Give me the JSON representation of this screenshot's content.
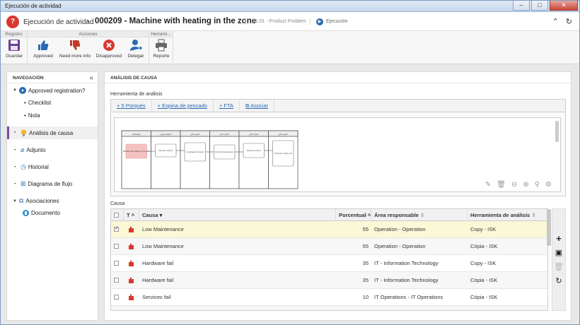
{
  "window": {
    "title": "Ejecución de actividad"
  },
  "header": {
    "breadcrumb": "Ejecución de actividad",
    "record": "000209 - Machine with heating in the zone",
    "category": "01.01 - Product Problem",
    "status": "Ejecución"
  },
  "ribbon": {
    "groups": {
      "registro": "Registro",
      "acciones": "Acciones",
      "herramientas": "Herrami..."
    },
    "buttons": {
      "guardar": "Guardar",
      "approved": "Approved",
      "need_more_info": "Need more info",
      "disapproved": "Disapproved",
      "delegar": "Delegar",
      "reporte": "Reporte"
    }
  },
  "nav": {
    "title": "NAVEGACIÓN",
    "items": {
      "approved": "Approved registration?",
      "checklist": "Checklist",
      "nota": "Nota",
      "analisis": "Análisis de causa",
      "adjunto": "Adjunto",
      "historial": "Historial",
      "diagrama": "Diagrama de flujo",
      "asociaciones": "Asociaciones",
      "documento": "Documento"
    }
  },
  "content": {
    "title": "ANÁLISIS DE CAUSA",
    "tool_label": "Herramienta de análisis",
    "tabs": {
      "t1": "5 Porqués",
      "t2": "Espina de pescado",
      "t3": "FTA",
      "t4": "Asociar"
    },
    "diagram": {
      "headers": [
        "Ishikawa",
        "¿Qué pasó?",
        "¿Por qué?",
        "¿Por qué?",
        "¿Por qué?",
        "¿Por qué?"
      ],
      "boxes": [
        "Machine with heating in the zone",
        "Stop the machine",
        "Investigate the cause",
        "Check the temperature",
        "Verify the sensors",
        "Check the cooling unit"
      ]
    },
    "cause_label": "Causa",
    "grid": {
      "headers": {
        "t": "T",
        "causa": "Causa",
        "porcentual": "Porcentual",
        "area": "Área responsable",
        "herramienta": "Herramienta de análisis"
      },
      "rows": [
        {
          "causa": "Low Maintenance",
          "porcentual": "55",
          "area": "Operation - Operation",
          "herramienta": "Copy - ISK",
          "checked": true
        },
        {
          "causa": "Low Maintenance",
          "porcentual": "55",
          "area": "Operation - Operation",
          "herramienta": "Cópia - ISK",
          "checked": false
        },
        {
          "causa": "Hardware fail",
          "porcentual": "35",
          "area": "IT - Information Technology",
          "herramienta": "Copy - ISK",
          "checked": false
        },
        {
          "causa": "Hardware fail",
          "porcentual": "35",
          "area": "IT - Information Technology",
          "herramienta": "Cópia - ISK",
          "checked": false
        },
        {
          "causa": "Services fail",
          "porcentual": "10",
          "area": "IT Operations - IT Operations",
          "herramienta": "Cópia - ISK",
          "checked": false
        }
      ]
    }
  },
  "colors": {
    "accent": "#7a4ba0",
    "link": "#2a6ab3",
    "selected_row": "#fbf8d8",
    "brand_red": "#d9382e"
  }
}
